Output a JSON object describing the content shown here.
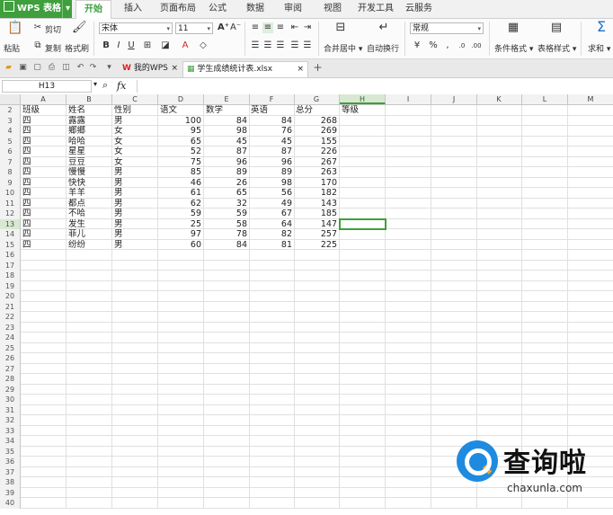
{
  "app": {
    "name": "WPS 表格"
  },
  "menu": {
    "tabs": [
      "开始",
      "插入",
      "页面布局",
      "公式",
      "数据",
      "审阅",
      "视图",
      "开发工具",
      "云服务"
    ],
    "active": "开始"
  },
  "ribbon": {
    "paste": "粘贴",
    "cut": "剪切",
    "copy": "复制",
    "format_painter": "格式刷",
    "font_name": "宋体",
    "font_size": "11",
    "bold": "B",
    "italic": "I",
    "underline": "U",
    "merge_center": "合并居中",
    "wrap_text": "自动换行",
    "number_format": "常规",
    "percent": "%",
    "conditional_format": "条件格式",
    "table_style": "表格样式",
    "sum": "求和"
  },
  "doc_tabs": [
    {
      "label": "我的WPS"
    },
    {
      "label": "学生成绩统计表.xlsx"
    }
  ],
  "formula_bar": {
    "name_box": "H13",
    "fx": "fx",
    "content": ""
  },
  "sheet": {
    "columns": [
      "A",
      "B",
      "C",
      "D",
      "E",
      "F",
      "G",
      "H",
      "I",
      "J",
      "K",
      "L",
      "M"
    ],
    "active_column": "H",
    "first_row": 2,
    "last_row": 40,
    "active_row": 13,
    "header": [
      "班级",
      "姓名",
      "性别",
      "语文",
      "数学",
      "英语",
      "总分",
      "等级"
    ],
    "data": [
      [
        "四",
        "露露",
        "男",
        "100",
        "84",
        "84",
        "268"
      ],
      [
        "四",
        "鄉鄉",
        "女",
        "95",
        "98",
        "76",
        "269"
      ],
      [
        "四",
        "哈哈",
        "女",
        "65",
        "45",
        "45",
        "155"
      ],
      [
        "四",
        "星星",
        "女",
        "52",
        "87",
        "87",
        "226"
      ],
      [
        "四",
        "豆豆",
        "女",
        "75",
        "96",
        "96",
        "267"
      ],
      [
        "四",
        "慢慢",
        "男",
        "85",
        "89",
        "89",
        "263"
      ],
      [
        "四",
        "快快",
        "男",
        "46",
        "26",
        "98",
        "170"
      ],
      [
        "四",
        "羊羊",
        "男",
        "61",
        "65",
        "56",
        "182"
      ],
      [
        "四",
        "都点",
        "男",
        "62",
        "32",
        "49",
        "143"
      ],
      [
        "四",
        "不哈",
        "男",
        "59",
        "59",
        "67",
        "185"
      ],
      [
        "四",
        "发生",
        "男",
        "25",
        "58",
        "64",
        "147"
      ],
      [
        "四",
        "菲儿",
        "男",
        "97",
        "78",
        "82",
        "257"
      ],
      [
        "四",
        "纷纷",
        "男",
        "60",
        "84",
        "81",
        "225"
      ]
    ]
  },
  "watermark": {
    "title": "查询啦",
    "url": "chaxunla.com"
  },
  "colors": {
    "accent": "#3e9f3c",
    "brand_blue": "#1e8be0"
  }
}
